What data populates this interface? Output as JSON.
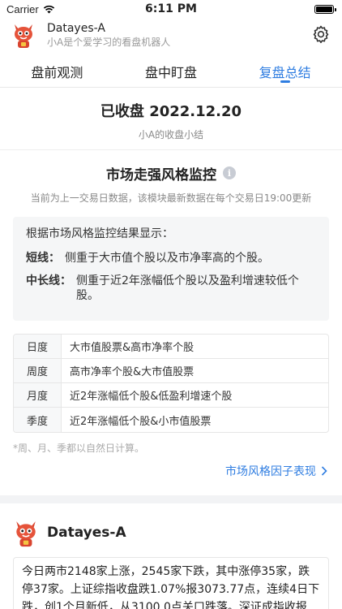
{
  "status_bar": {
    "carrier": "Carrier",
    "time": "6:11 PM"
  },
  "header": {
    "app_name": "Datayes-A",
    "subtitle": "小A是个爱学习的看盘机器人"
  },
  "tabs": [
    {
      "label": "盘前观测",
      "active": false
    },
    {
      "label": "盘中盯盘",
      "active": false
    },
    {
      "label": "复盘总结",
      "active": true
    }
  ],
  "closing": {
    "title": "已收盘 2022.12.20",
    "subtitle": "小A的收盘小结"
  },
  "style_monitor": {
    "title": "市场走强风格监控",
    "note": "当前为上一交易日数据，该模块最新数据在每个交易日19:00更新",
    "summary_head": "根据市场风格监控结果显示：",
    "short_key": "短线：",
    "short_text": "侧重于大市值个股以及市净率高的个股。",
    "long_key": "中长线：",
    "long_text": "侧重于近2年涨幅低个股以及盈利增速较低个股。",
    "periods": [
      {
        "key": "日度",
        "value": "大市值股票&高市净率个股"
      },
      {
        "key": "周度",
        "value": "高市净率个股&大市值股票"
      },
      {
        "key": "月度",
        "value": "近2年涨幅低个股&低盈利增速个股"
      },
      {
        "key": "季度",
        "value": "近2年涨幅低个股&小市值股票"
      }
    ],
    "footnote": "*周、月、季都以自然日计算。",
    "factor_link": "市场风格因子表现"
  },
  "bot": {
    "name": "Datayes-A",
    "recap": "今日两市2148家上涨，2545家下跌，其中涨停35家，跌停37家。上证综指收盘跌1.07%报3073.77点，连续4日下跌，创1个月新低，从3100.0点关口跌落。深证成指收报"
  },
  "colors": {
    "accent": "#2f7de1",
    "mascot": "#d9442f"
  },
  "icons": {
    "settings": "gear-icon",
    "info": "info-icon",
    "chevron": "chevron-right-icon",
    "mascot": "mascot-icon"
  }
}
